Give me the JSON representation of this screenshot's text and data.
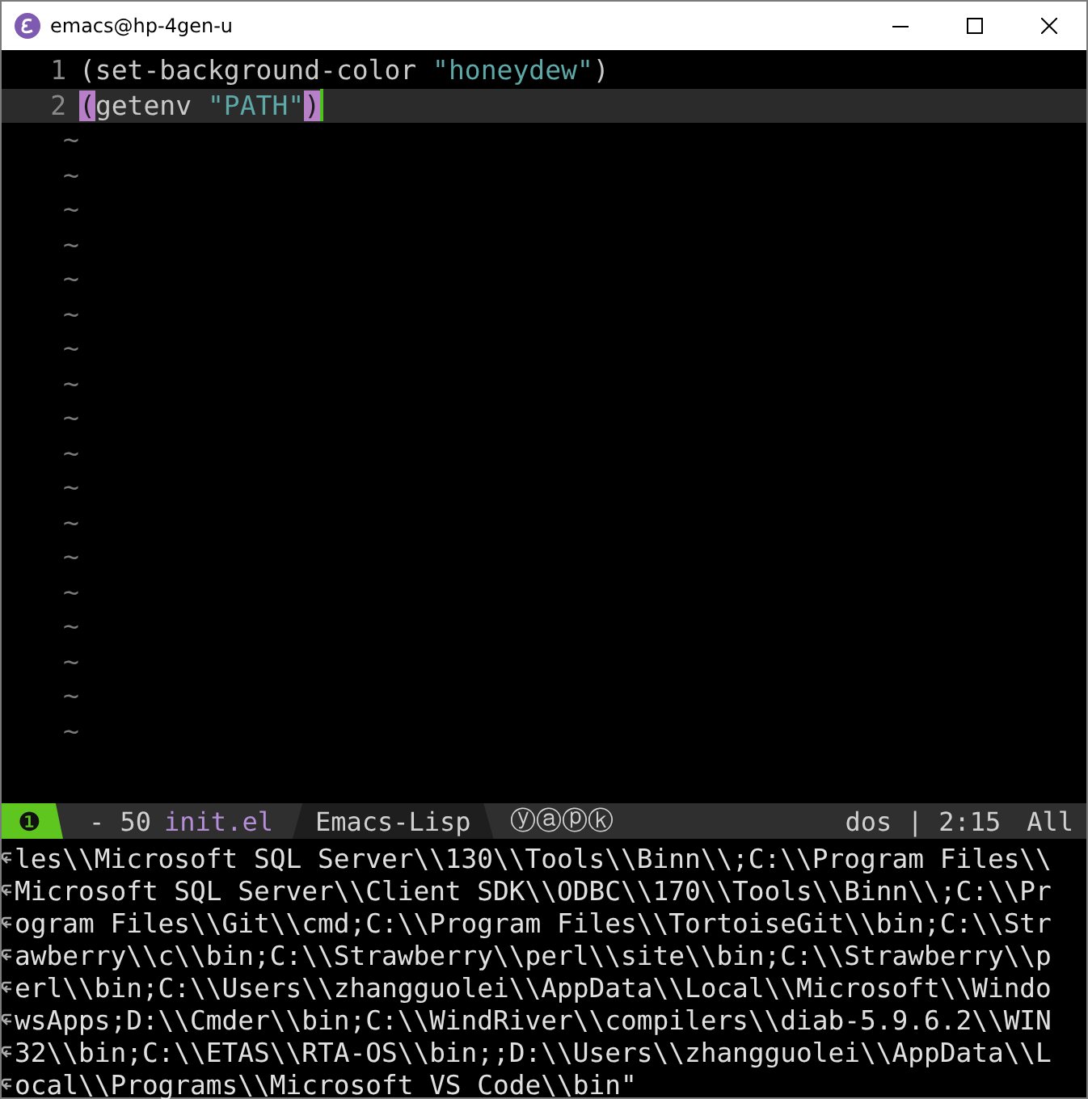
{
  "window": {
    "title": "emacs@hp-4gen-u"
  },
  "editor": {
    "lines": [
      {
        "number": "1",
        "current": false,
        "tokens": [
          {
            "kind": "plain",
            "text": "(set-background-color "
          },
          {
            "kind": "string",
            "text": "\"honeydew\""
          },
          {
            "kind": "plain",
            "text": ")"
          }
        ]
      },
      {
        "number": "2",
        "current": true,
        "tokens": [
          {
            "kind": "paren-match",
            "text": "("
          },
          {
            "kind": "plain",
            "text": "getenv "
          },
          {
            "kind": "string",
            "text": "\"PATH\""
          },
          {
            "kind": "paren-match",
            "text": ")"
          },
          {
            "kind": "cursor"
          }
        ]
      }
    ],
    "empty_line_marks": [
      "~",
      "~",
      "~",
      "~",
      "~",
      "~",
      "~",
      "~",
      "~",
      "~",
      "~",
      "~",
      "~",
      "~",
      "~",
      "~",
      "~",
      "~"
    ]
  },
  "mode_line": {
    "window_number": "❶",
    "state": "- 50",
    "buffer": "init.el",
    "major_mode": "Emacs-Lisp",
    "minor_modes": "ⓨⓐⓟⓚ",
    "encoding_position": "dos | 2:15",
    "scroll": "All"
  },
  "echo_area": {
    "lines": [
      "les\\\\Microsoft SQL Server\\\\130\\\\Tools\\\\Binn\\\\;C:\\\\Program Files\\\\",
      "Microsoft SQL Server\\\\Client SDK\\\\ODBC\\\\170\\\\Tools\\\\Binn\\\\;C:\\\\Pr",
      "ogram Files\\\\Git\\\\cmd;C:\\\\Program Files\\\\TortoiseGit\\\\bin;C:\\\\Str",
      "awberry\\\\c\\\\bin;C:\\\\Strawberry\\\\perl\\\\site\\\\bin;C:\\\\Strawberry\\\\p",
      "erl\\\\bin;C:\\\\Users\\\\zhangguolei\\\\AppData\\\\Local\\\\Microsoft\\\\Windo",
      "wsApps;D:\\\\Cmder\\\\bin;C:\\\\WindRiver\\\\compilers\\\\diab-5.9.6.2\\\\WIN",
      "32\\\\bin;C:\\\\ETAS\\\\RTA-OS\\\\bin;;D:\\\\Users\\\\zhangguolei\\\\AppData\\\\L",
      "ocal\\\\Programs\\\\Microsoft VS Code\\\\bin\""
    ]
  }
}
